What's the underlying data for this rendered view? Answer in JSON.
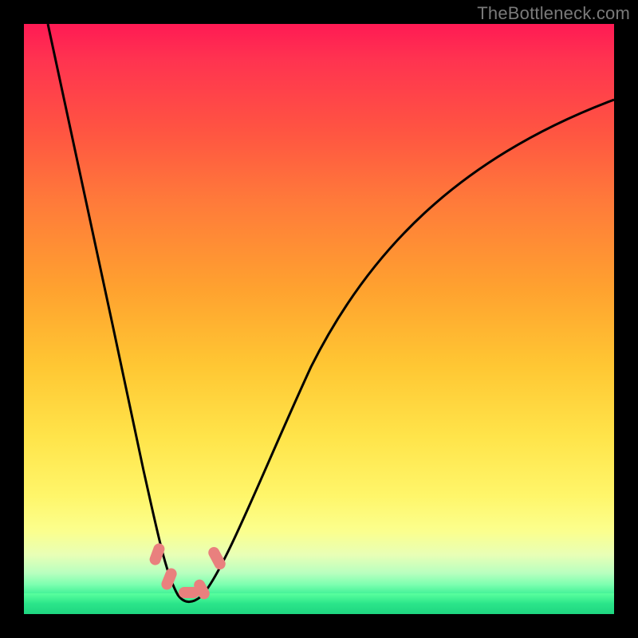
{
  "watermark": "TheBottleneck.com",
  "chart_data": {
    "type": "line",
    "title": "",
    "xlabel": "",
    "ylabel": "",
    "xlim": [
      0,
      100
    ],
    "ylim": [
      0,
      100
    ],
    "grid": false,
    "legend": false,
    "series": [
      {
        "name": "bottleneck-curve",
        "x": [
          4,
          8,
          12,
          16,
          20,
          23,
          25,
          27,
          29,
          30,
          33,
          36,
          40,
          46,
          54,
          64,
          76,
          88,
          100
        ],
        "y": [
          100,
          82,
          64,
          46,
          28,
          14,
          6,
          2,
          2,
          4,
          10,
          20,
          32,
          46,
          60,
          72,
          80,
          85,
          88
        ]
      }
    ],
    "markers": [
      {
        "name": "marker-a",
        "x": 22.5,
        "y": 8
      },
      {
        "name": "marker-b",
        "x": 24.5,
        "y": 4
      },
      {
        "name": "marker-c",
        "x": 27.0,
        "y": 2
      },
      {
        "name": "marker-d",
        "x": 29.0,
        "y": 3
      },
      {
        "name": "marker-e",
        "x": 31.5,
        "y": 8
      }
    ],
    "colors": {
      "curve": "#000000",
      "marker_fill": "#e9807e",
      "gradient_top": "#ff1a54",
      "gradient_bottom": "#1fd680"
    }
  }
}
